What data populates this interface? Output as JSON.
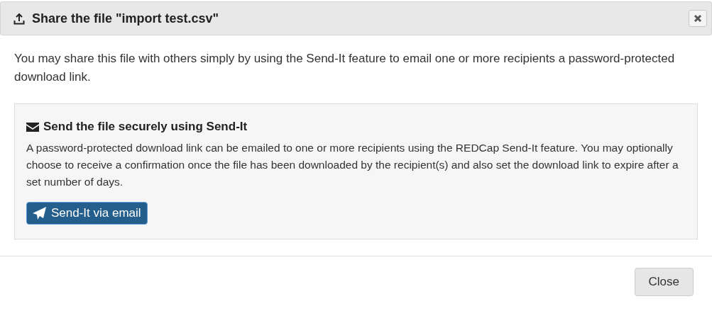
{
  "dialog": {
    "title": "Share the file \"import test.csv\"",
    "intro": "You may share this file with others simply by using the Send-It feature to email one or more recipients a password-protected download link.",
    "panel": {
      "heading": "Send the file securely using Send-It",
      "description": "A password-protected download link can be emailed to one or more recipients using the REDCap Send-It feature. You may optionally choose to receive a confirmation once the file has been downloaded by the recipient(s) and also set the download link to expire after a set number of days.",
      "button": "Send-It via email"
    },
    "footer_buttons": [
      "Close"
    ]
  }
}
